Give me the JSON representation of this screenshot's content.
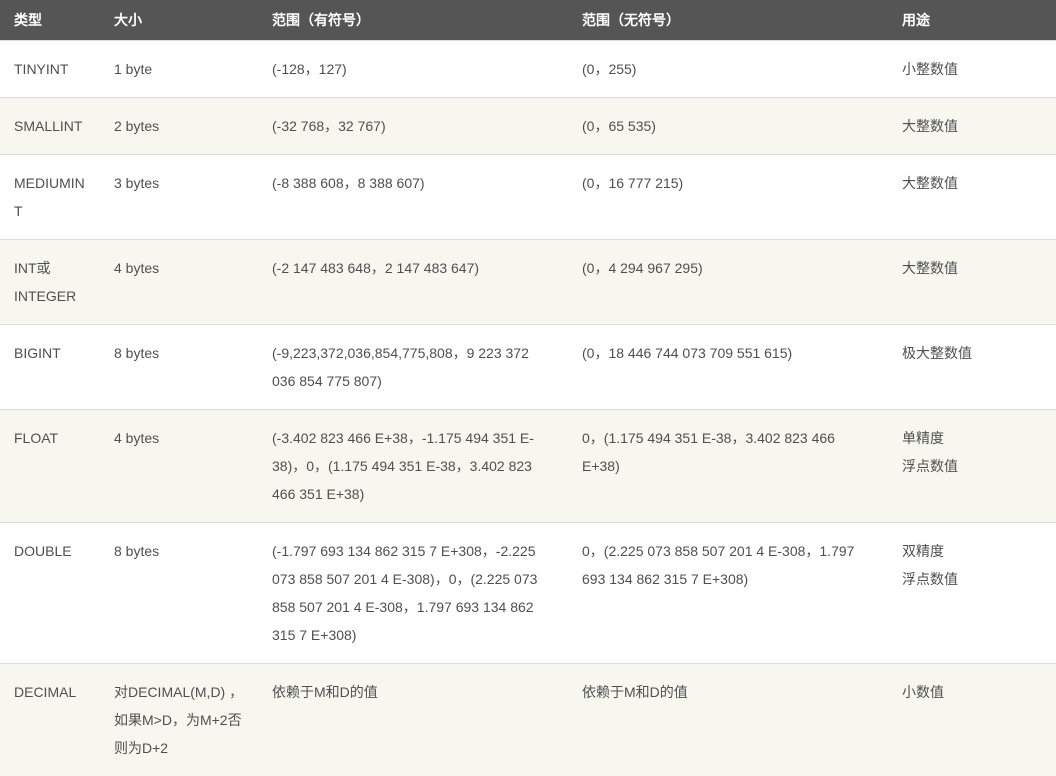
{
  "table": {
    "headers": [
      "类型",
      "大小",
      "范围（有符号）",
      "范围（无符号）",
      "用途"
    ],
    "rows": [
      {
        "type": "TINYINT",
        "size": "1 byte",
        "signed": "(-128，127)",
        "unsigned": "(0，255)",
        "usage": "小整数值"
      },
      {
        "type": "SMALLINT",
        "size": "2 bytes",
        "signed": "(-32 768，32 767)",
        "unsigned": "(0，65 535)",
        "usage": "大整数值"
      },
      {
        "type": "MEDIUMINT",
        "size": "3 bytes",
        "signed": "(-8 388 608，8 388 607)",
        "unsigned": "(0，16 777 215)",
        "usage": "大整数值"
      },
      {
        "type": "INT或INTEGER",
        "size": "4 bytes",
        "signed": "(-2 147 483 648，2 147 483 647)",
        "unsigned": "(0，4 294 967 295)",
        "usage": "大整数值"
      },
      {
        "type": "BIGINT",
        "size": "8 bytes",
        "signed": "(-9,223,372,036,854,775,808，9 223 372 036 854 775 807)",
        "unsigned": "(0，18 446 744 073 709 551 615)",
        "usage": "极大整数值"
      },
      {
        "type": "FLOAT",
        "size": "4 bytes",
        "signed": "(-3.402 823 466 E+38，-1.175 494 351 E-38)，0，(1.175 494 351 E-38，3.402 823 466 351 E+38)",
        "unsigned": "0，(1.175 494 351 E-38，3.402 823 466 E+38)",
        "usage": "单精度\n浮点数值"
      },
      {
        "type": "DOUBLE",
        "size": "8 bytes",
        "signed": "(-1.797 693 134 862 315 7 E+308，-2.225 073 858 507 201 4 E-308)，0，(2.225 073 858 507 201 4 E-308，1.797 693 134 862 315 7 E+308)",
        "unsigned": "0，(2.225 073 858 507 201 4 E-308，1.797 693 134 862 315 7 E+308)",
        "usage": "双精度\n浮点数值"
      },
      {
        "type": "DECIMAL",
        "size": "对DECIMAL(M,D) ，如果M>D，为M+2否则为D+2",
        "signed": "依赖于M和D的值",
        "unsigned": "依赖于M和D的值",
        "usage": "小数值"
      }
    ]
  },
  "watermark": ""
}
